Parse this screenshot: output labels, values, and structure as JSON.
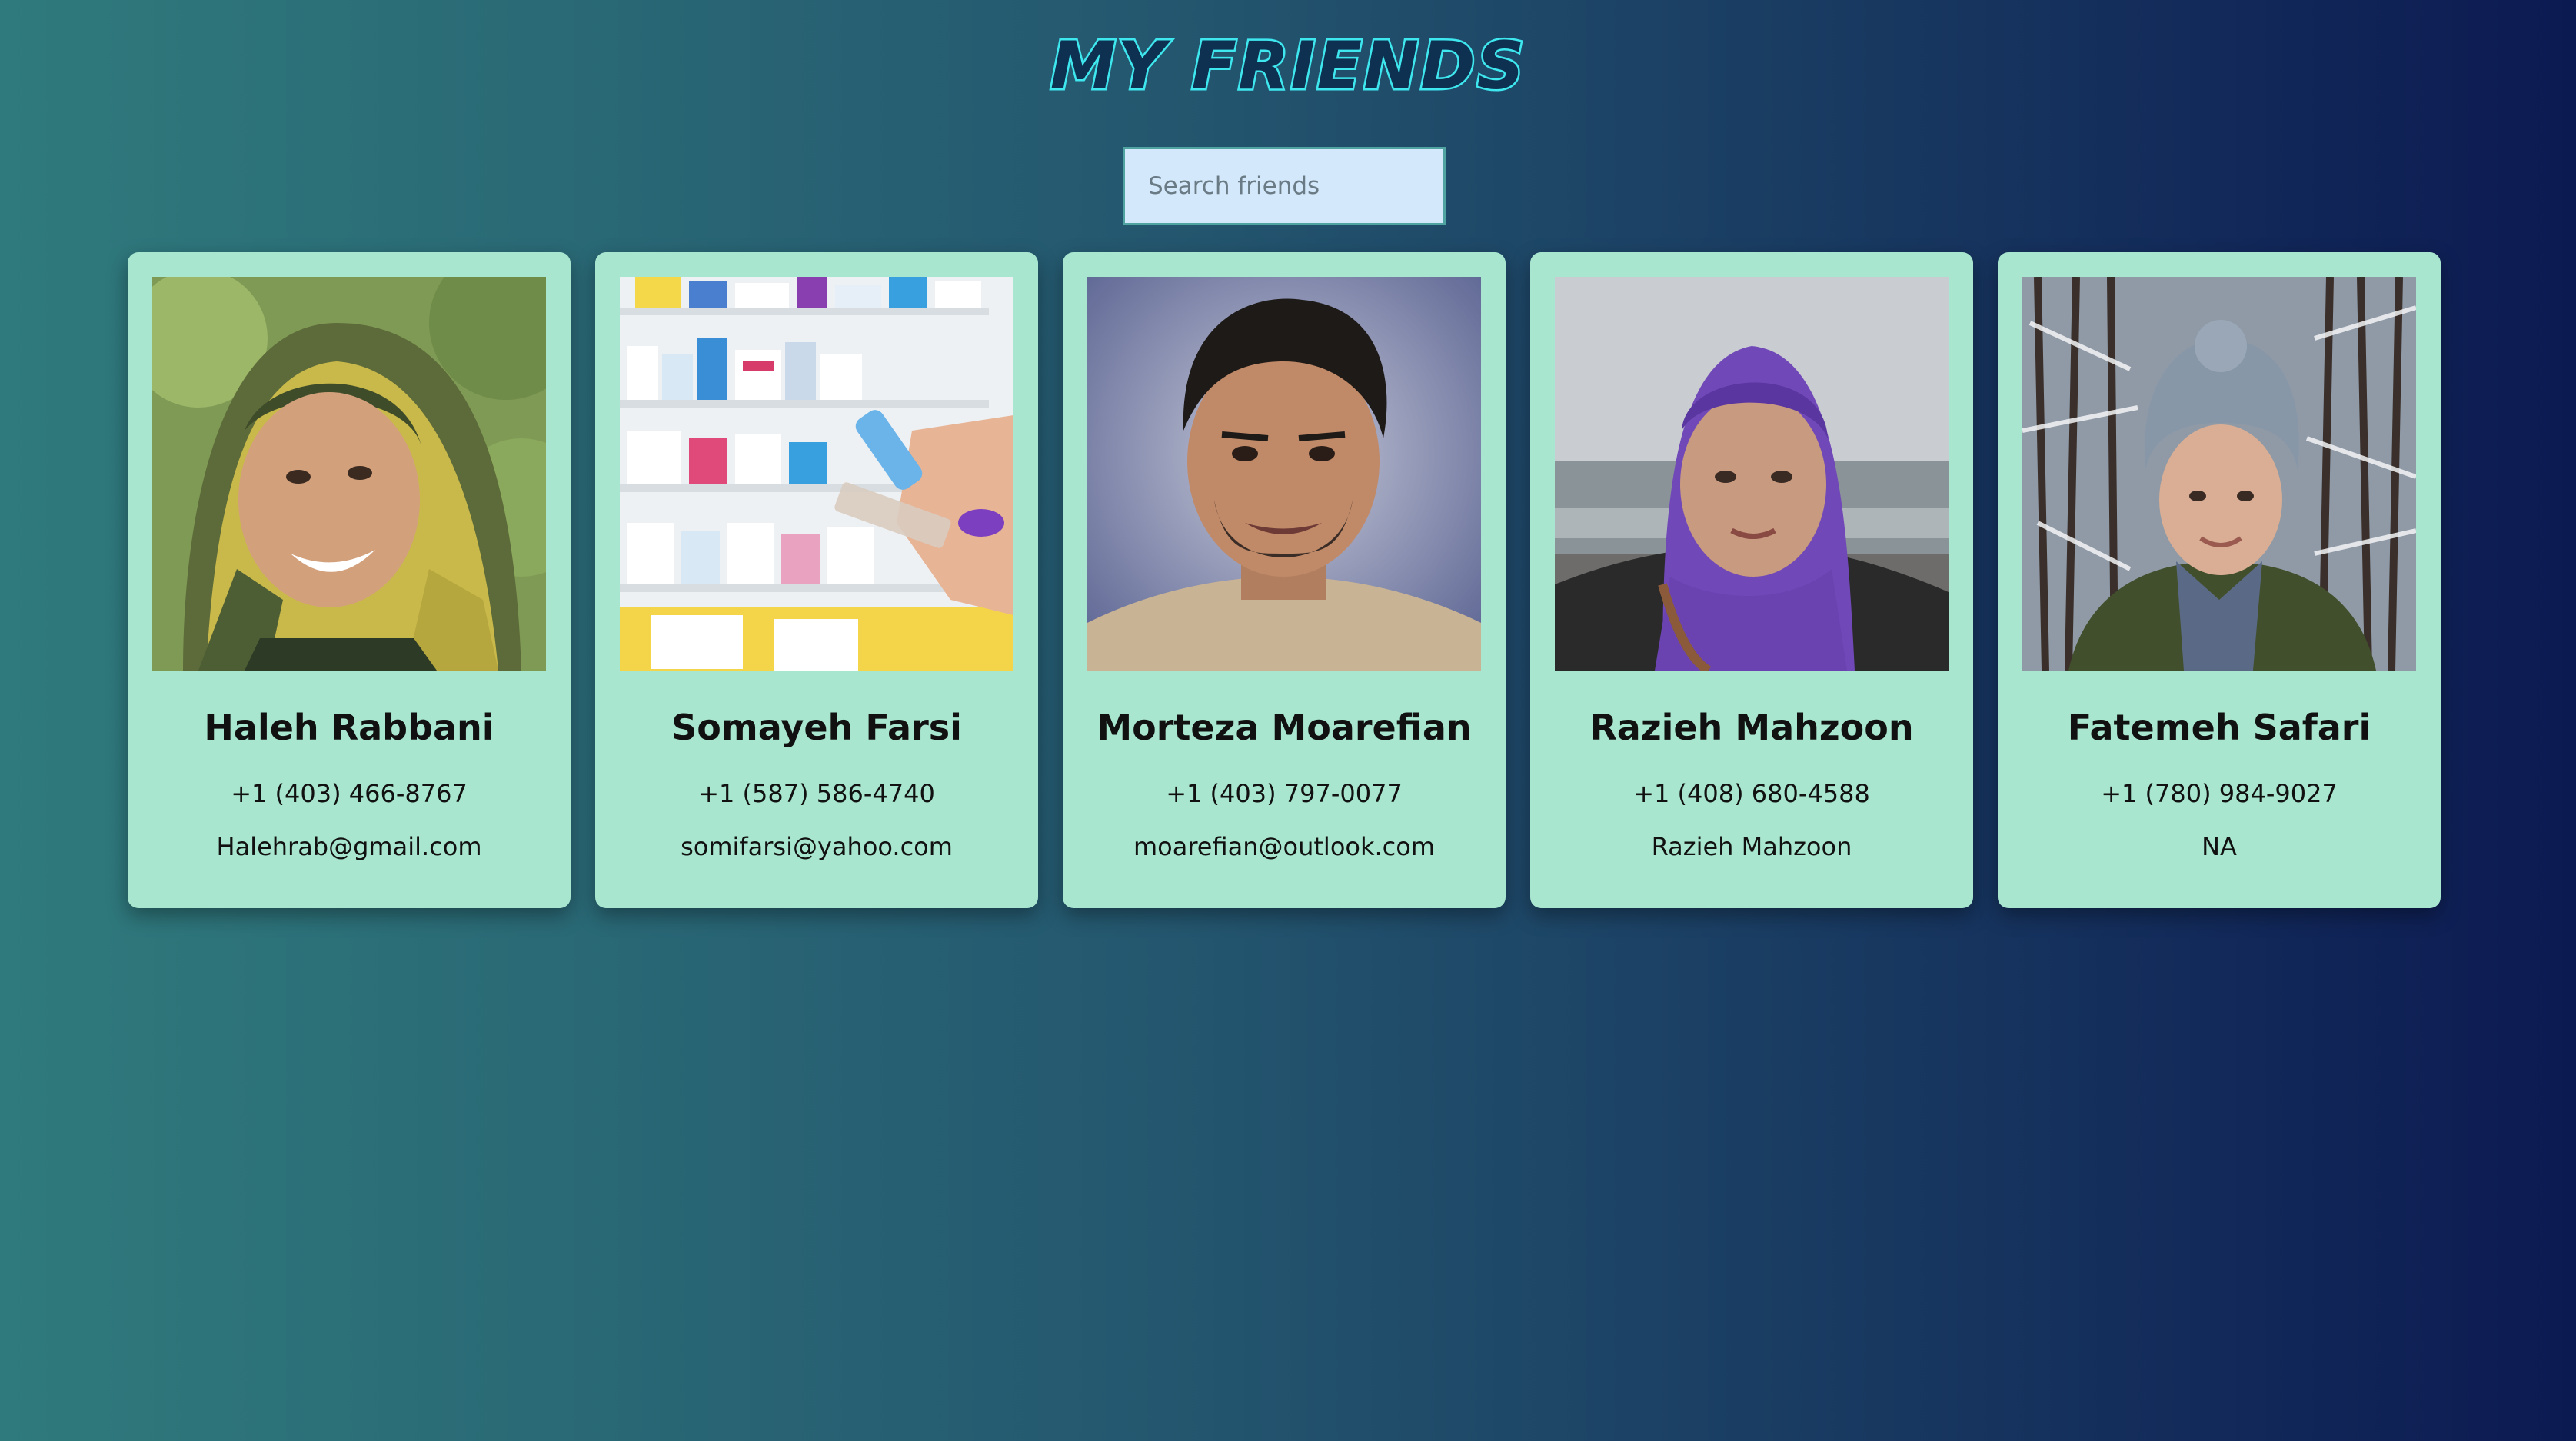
{
  "app": {
    "title": "MY FRIENDS"
  },
  "search": {
    "placeholder": "Search friends"
  },
  "friends": [
    {
      "name": "Haleh Rabbani",
      "phone": "+1 (403) 466-8767",
      "email": "Halehrab@gmail.com",
      "photo_icon": "portrait-photo"
    },
    {
      "name": "Somayeh Farsi",
      "phone": "+1 (587) 586-4740",
      "email": "somifarsi@yahoo.com",
      "photo_icon": "pharmacy-shelf-photo"
    },
    {
      "name": "Morteza Moarefian",
      "phone": "+1 (403) 797-0077",
      "email": "moarefian@outlook.com",
      "photo_icon": "portrait-photo"
    },
    {
      "name": "Razieh Mahzoon",
      "phone": "+1 (408) 680-4588",
      "email": "Razieh Mahzoon",
      "photo_icon": "portrait-photo"
    },
    {
      "name": "Fatemeh Safari",
      "phone": "+1 (780) 984-9027",
      "email": "NA",
      "photo_icon": "portrait-photo"
    }
  ],
  "colors": {
    "card_background": "#a8e6cf",
    "title_outline": "#3ee6ee",
    "search_background": "#d3e9fb",
    "gradient_start": "#2f7a7c",
    "gradient_end": "#0c1a52"
  }
}
